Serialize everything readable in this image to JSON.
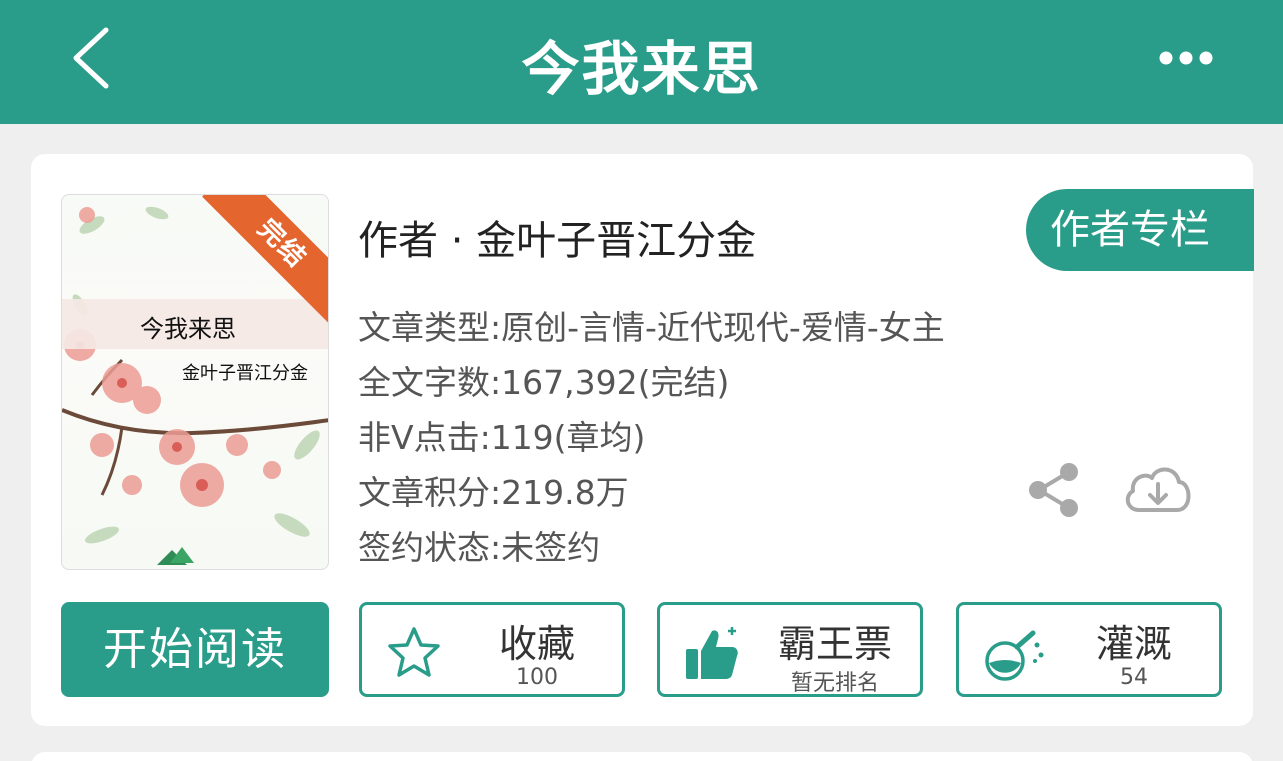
{
  "header": {
    "title": "今我来思",
    "back_icon": "chevron-left-icon",
    "more_icon": "more-horizontal-icon"
  },
  "book": {
    "cover_title": "今我来思",
    "cover_author": "金叶子晋江分金",
    "status_ribbon": "完结",
    "author_line": "作者 · 金叶子晋江分金",
    "author_column_button": "作者专栏",
    "meta": {
      "type": "文章类型:原创-言情-近代现代-爱情-女主",
      "word_count": "全文字数:167,392(完结)",
      "clicks": "非Ⅴ点击:119(章均)",
      "score": "文章积分:219.8万",
      "contract": "签约状态:未签约"
    }
  },
  "actions": {
    "read": "开始阅读",
    "favorite": {
      "label": "收藏",
      "sub": "100",
      "icon": "star-icon"
    },
    "vote": {
      "label": "霸王票",
      "sub": "暂无排名",
      "icon": "thumbs-up-icon"
    },
    "water": {
      "label": "灌溉",
      "sub": "54",
      "icon": "watering-flask-icon"
    }
  },
  "icons": {
    "share": "share-icon",
    "download": "cloud-download-icon"
  },
  "colors": {
    "brand": "#2a9d8a",
    "ribbon": "#e5652e",
    "background": "#efefef"
  }
}
